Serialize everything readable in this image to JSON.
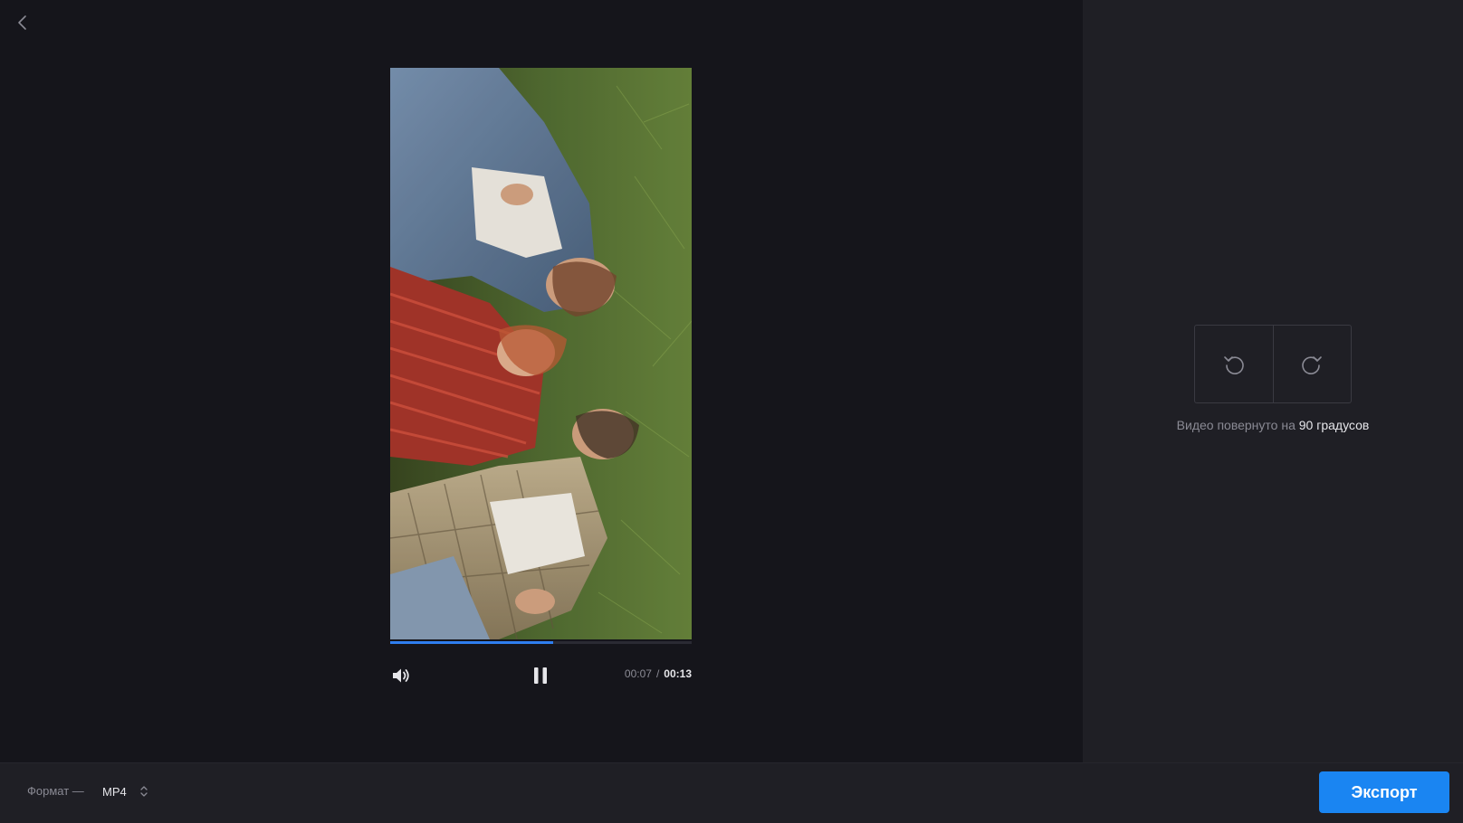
{
  "navigation": {
    "back_icon": "chevron-left-icon"
  },
  "player": {
    "video_description": "Three young people lying on green grass, shot from above, rotated 90 degrees",
    "progress": 0.54,
    "current_time": "00:07",
    "separator": "/",
    "total_time": "00:13",
    "volume_icon": "speaker-icon",
    "pause_icon": "pause-icon",
    "accent_color": "#2f7ef0"
  },
  "rotation": {
    "rotate_left_icon": "rotate-ccw-icon",
    "rotate_right_icon": "rotate-cw-icon",
    "caption_prefix": "Видео повернуто на",
    "caption_degrees": "90 градусов"
  },
  "footer": {
    "format_label": "Формат —",
    "format_value": "MP4",
    "format_chevron_icon": "chevron-up-down-icon",
    "export_label": "Экспорт",
    "export_color": "#1a85f2"
  }
}
